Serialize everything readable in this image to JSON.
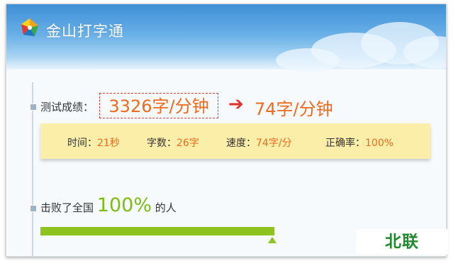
{
  "app": {
    "title": "金山打字通"
  },
  "result": {
    "score_label": "测试成绩：",
    "original_speed": "3326字/分钟",
    "arrow": "➔",
    "new_speed": "74字/分钟"
  },
  "stats": [
    {
      "label": "时间：",
      "value": "21秒"
    },
    {
      "label": "字数：",
      "value": "26字"
    },
    {
      "label": "速度：",
      "value": "74字/分"
    },
    {
      "label": "正确率：",
      "value": "100%"
    }
  ],
  "ranking": {
    "prefix": "击败了全国",
    "percent": "100%",
    "suffix": "的人",
    "progress_fraction": 1.0
  },
  "watermark": "北联",
  "colors": {
    "accent_orange": "#ee6a1c",
    "arrow_red": "#e3322d",
    "progress_green": "#8dc21f",
    "stats_bg": "#fbeea9"
  }
}
